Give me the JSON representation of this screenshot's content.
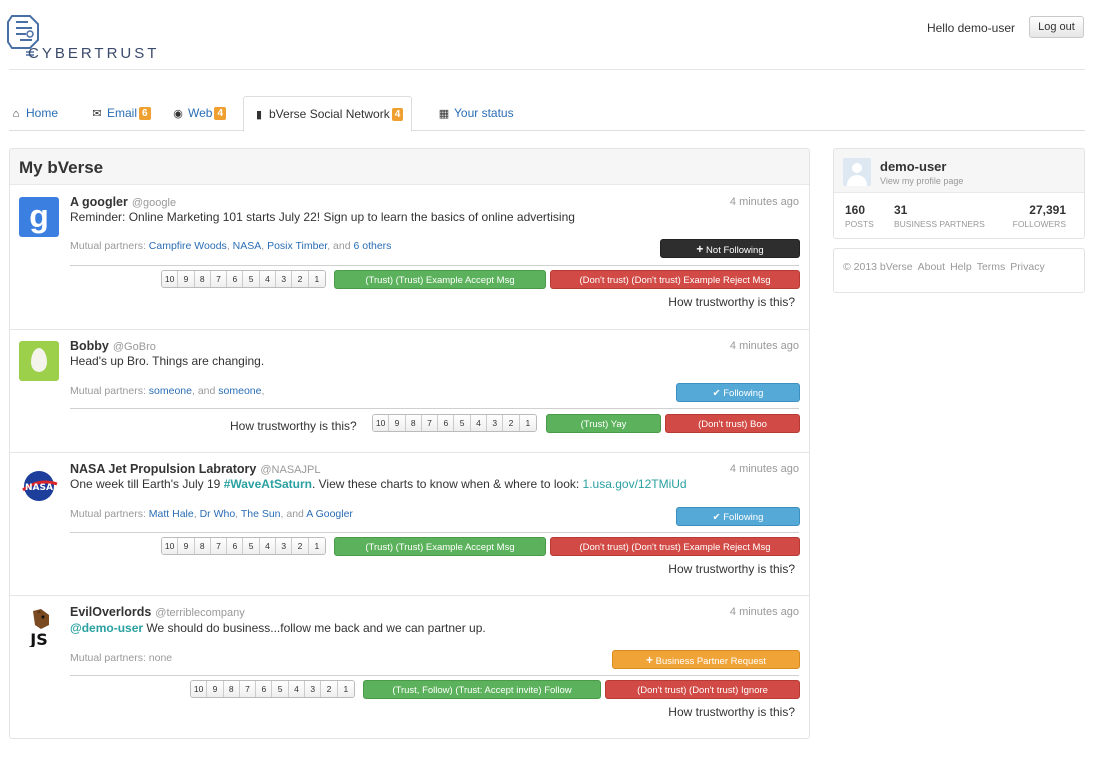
{
  "brand": {
    "name": "CYBERTRUST"
  },
  "header": {
    "greeting": "Hello demo-user",
    "logout_label": "Log out"
  },
  "tabs": [
    {
      "label": "Home",
      "icon": "home-icon",
      "badge": ""
    },
    {
      "label": "Email",
      "icon": "envelope-icon",
      "badge": "6"
    },
    {
      "label": "Web",
      "icon": "globe-icon",
      "badge": "4"
    },
    {
      "label": "bVerse Social Network",
      "icon": "comment-icon",
      "badge": "4"
    },
    {
      "label": "Your status",
      "icon": "grid-icon",
      "badge": ""
    }
  ],
  "feed": {
    "title": "My bVerse",
    "scale": [
      "10",
      "9",
      "8",
      "7",
      "6",
      "5",
      "4",
      "3",
      "2",
      "1"
    ],
    "question": "How trustworthy is this?",
    "mutual_prefix": "Mutual partners:",
    "posts": [
      {
        "name": "A googler",
        "handle": "@google",
        "time": "4 minutes ago",
        "text": "Reminder: Online Marketing 101 starts July 22! Sign up to learn the basics of online advertising",
        "m1": "Campfire Woods",
        "m2": "NASA",
        "m3": "Posix Timber",
        "and": ", and",
        "m4": "6 others",
        "follow": "Not Following",
        "accept": "(Trust) (Trust) Example Accept Msg",
        "reject": "(Don't trust) (Don't trust) Example Reject Msg"
      },
      {
        "name": "Bobby",
        "handle": "@GoBro",
        "time": "4 minutes ago",
        "text": "Head's up Bro. Things are changing.",
        "m1": "someone",
        "and": ", and",
        "m2": "someone",
        "follow": "Following",
        "accept": "(Trust) Yay",
        "reject": "(Don't trust) Boo"
      },
      {
        "name": "NASA Jet Propulsion Labratory",
        "handle": "@NASAJPL",
        "time": "4 minutes ago",
        "text_a": "One week till Earth's July 19 ",
        "hashtag": "#WaveAtSaturn",
        "text_b": ". View these charts to know when & where to look: ",
        "link": "1.usa.gov/12TMiUd",
        "m1": "Matt Hale",
        "m2": "Dr Who",
        "m3": "The Sun",
        "and": ", and",
        "m4": "A Googler",
        "follow": "Following",
        "accept": "(Trust) (Trust) Example Accept Msg",
        "reject": "(Don't trust) (Don't trust) Example Reject Msg"
      },
      {
        "name": "EvilOverlords",
        "handle": "@terriblecompany",
        "time": "4 minutes ago",
        "mention": "@demo-user",
        "text": " We should do business...follow me back and we can partner up.",
        "mutual": "Mutual partners: none",
        "follow": "Business Partner Request",
        "accept": "(Trust, Follow) (Trust: Accept invite) Follow",
        "reject": "(Don't trust) (Don't trust) Ignore"
      }
    ]
  },
  "profile": {
    "name": "demo-user",
    "link": "View my profile page",
    "stats": [
      {
        "value": "160",
        "label": "POSTS"
      },
      {
        "value": "31",
        "label": "BUSINESS PARTNERS"
      },
      {
        "value": "27,391",
        "label": "FOLLOWERS"
      }
    ]
  },
  "footer": {
    "copyright": "© 2013 bVerse",
    "links": [
      "About",
      "Help",
      "Terms",
      "Privacy"
    ]
  },
  "colors": {
    "accent": "#2a6db5",
    "badge": "#f0a030",
    "trust": "#5cb25c",
    "distrust": "#d24a45",
    "following": "#55a9d6",
    "request": "#f0a336",
    "not_following": "#2e2e2e"
  }
}
